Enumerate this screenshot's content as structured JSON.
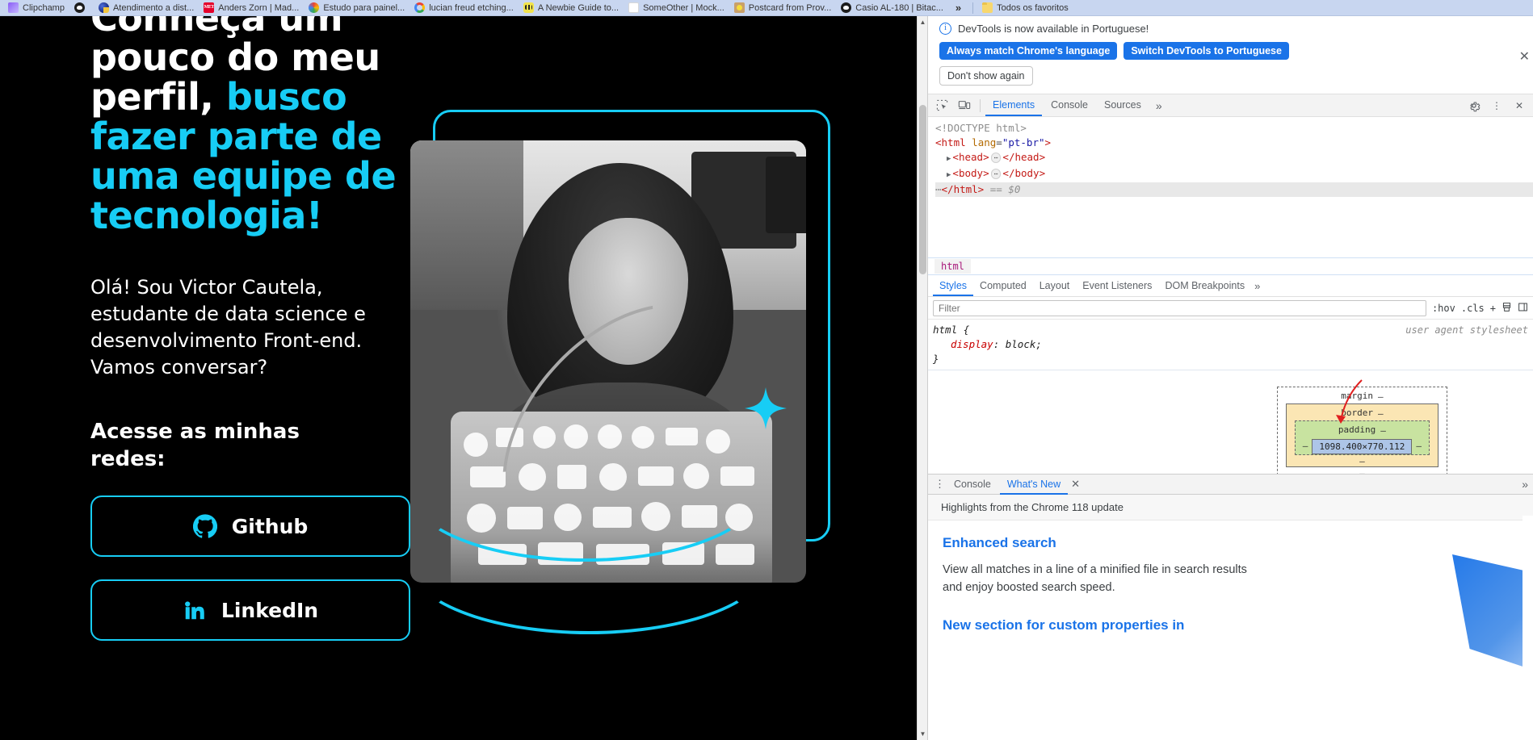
{
  "bookmarks": {
    "items": [
      {
        "label": "Clipchamp",
        "icon": "clipchamp-favicon"
      },
      {
        "label": "",
        "icon": "dark-circle-favicon"
      },
      {
        "label": "Atendimento a dist...",
        "icon": "blue-globe-favicon"
      },
      {
        "label": "Anders Zorn | Mad...",
        "icon": "met-museum-favicon"
      },
      {
        "label": "Estudo para painel...",
        "icon": "rainbow-favicon"
      },
      {
        "label": "lucian freud etching...",
        "icon": "google-favicon"
      },
      {
        "label": "A Newbie Guide to...",
        "icon": "bee-favicon"
      },
      {
        "label": "SomeOther | Mock...",
        "icon": "blank-favicon"
      },
      {
        "label": "Postcard from Prov...",
        "icon": "lemon-favicon"
      },
      {
        "label": "",
        "icon": "dark-circle-favicon"
      },
      {
        "label": "Casio AL-180 | Bitac...",
        "icon": "dark-circle-favicon"
      }
    ],
    "overflow_label": "»",
    "all_bookmarks_label": "Todos os favoritos",
    "all_bookmarks_icon": "folder-icon"
  },
  "page": {
    "heading_line1": "Conheça um",
    "heading_line2": "pouco do meu",
    "heading_line3": "perfil, ",
    "heading_accent1": "busco",
    "heading_accent2": "fazer parte de",
    "heading_accent3": "uma equipe de",
    "heading_accent4": "tecnologia!",
    "subtitle": "Olá! Sou Victor Cautela, estudante de data science e desenvolvimento Front-end. Vamos conversar?",
    "redes_title": "Acesse as minhas redes:",
    "buttons": [
      {
        "label": "Github",
        "icon": "github-icon"
      },
      {
        "label": "LinkedIn",
        "icon": "linkedin-icon"
      }
    ],
    "accent_color": "#17cdf5",
    "background_color": "#000000"
  },
  "devtools": {
    "info_banner": {
      "icon": "info-icon",
      "message": "DevTools is now available in Portuguese!",
      "primary_button": "Always match Chrome's language",
      "secondary_button": "Switch DevTools to Portuguese",
      "dismiss_button": "Don't show again",
      "close_icon": "close-icon"
    },
    "toolbar": {
      "inspect_icon": "inspect-element-icon",
      "device_icon": "device-toolbar-icon",
      "tabs": [
        {
          "label": "Elements",
          "active": true
        },
        {
          "label": "Console",
          "active": false
        },
        {
          "label": "Sources",
          "active": false
        }
      ],
      "more_tabs": "»",
      "settings_icon": "gear-icon",
      "kebab_icon": "more-options-icon",
      "close_icon": "close-devtools-icon"
    },
    "dom": {
      "lines": [
        {
          "text": "<!DOCTYPE html>",
          "kind": "doctype"
        },
        {
          "text": "<html lang=\"pt-br\">",
          "kind": "tag-open"
        },
        {
          "text": "<head> … </head>",
          "kind": "collapsed"
        },
        {
          "text": "<body> … </body>",
          "kind": "collapsed"
        },
        {
          "text": "</html> == $0",
          "kind": "tag-close-selected"
        }
      ],
      "doctype": "<!DOCTYPE html>",
      "html_tag": "html",
      "html_attr_name": "lang",
      "html_attr_value": "\"pt-br\"",
      "head_tag": "head",
      "body_tag": "body",
      "close_html": "</html>",
      "selected_marker": "== $0"
    },
    "breadcrumb": {
      "items": [
        "html"
      ]
    },
    "sidebar_tabs": [
      {
        "label": "Styles",
        "active": true
      },
      {
        "label": "Computed",
        "active": false
      },
      {
        "label": "Layout",
        "active": false
      },
      {
        "label": "Event Listeners",
        "active": false
      },
      {
        "label": "DOM Breakpoints",
        "active": false
      }
    ],
    "sidebar_more": "»",
    "filter": {
      "placeholder": "Filter",
      "value": "",
      "hov_label": ":hov",
      "cls_label": ".cls",
      "new_rule_icon": "plus-icon",
      "styles_icon": "print-styles-icon",
      "toggle_pane_icon": "toggle-sidebar-icon"
    },
    "rules": [
      {
        "selector": "html {",
        "source": "user agent stylesheet",
        "declarations": [
          {
            "property": "display",
            "value": "block;"
          }
        ],
        "close": "}"
      }
    ],
    "box_model": {
      "margin_label": "margin",
      "margin_value": "–",
      "border_label": "border",
      "border_value": "–",
      "padding_label": "padding",
      "padding_value": "–",
      "content_size": "1098.400×770.112",
      "dash": "–"
    },
    "drawer": {
      "kebab_icon": "drawer-more-icon",
      "tabs": [
        {
          "label": "Console",
          "active": false
        },
        {
          "label": "What's New",
          "active": true
        }
      ],
      "close_icon": "close-tab-icon",
      "right_icon": "drawer-more-right-icon"
    },
    "whats_new": {
      "header": "Highlights from the Chrome 118 update",
      "section1_title": "Enhanced search",
      "section1_body": "View all matches in a line of a minified file in search results and enjoy boosted search speed.",
      "section2_title": "New section for custom properties in"
    }
  }
}
